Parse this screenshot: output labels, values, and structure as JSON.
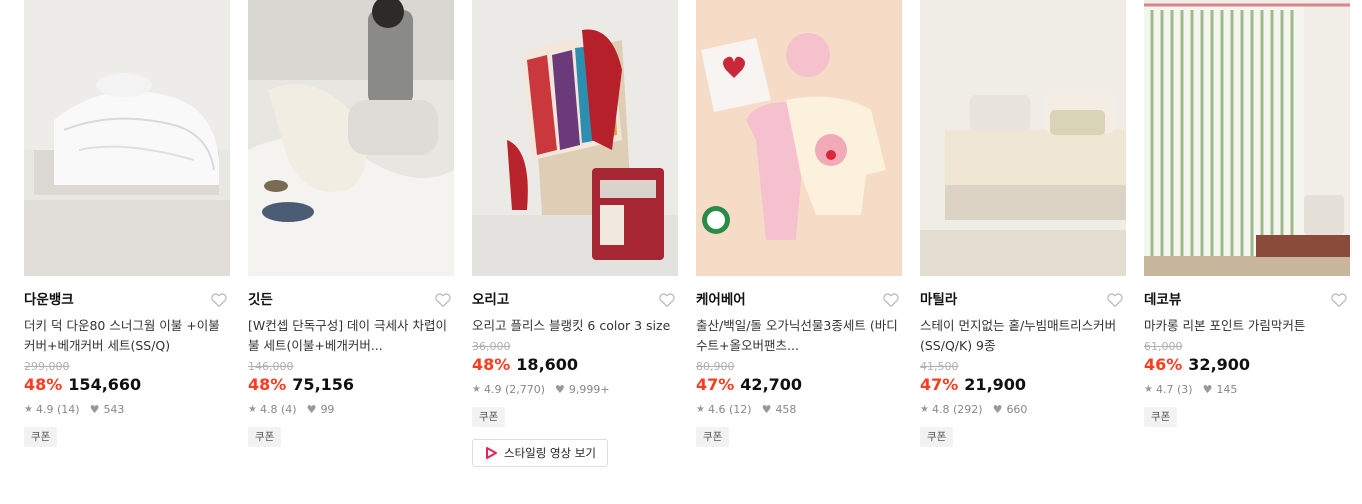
{
  "products": [
    {
      "brand": "다운뱅크",
      "title": "더키 덕 다운80 스너그웜 이불 +이불커버+베개커버 세트(SS/Q)",
      "original_price": "299,000",
      "discount": "48%",
      "price": "154,660",
      "rating": "4.9",
      "reviews": "(14)",
      "likes": "543",
      "coupon": "쿠폰"
    },
    {
      "brand": "깃든",
      "title": "[W컨셉 단독구성] 데이 극세사 차렵이불 세트(이불+베개커버...",
      "original_price": "146,000",
      "discount": "48%",
      "price": "75,156",
      "rating": "4.8",
      "reviews": "(4)",
      "likes": "99",
      "coupon": "쿠폰"
    },
    {
      "brand": "오리고",
      "title": "오리고 플리스 블랭킷 6 color 3 size",
      "original_price": "36,000",
      "discount": "48%",
      "price": "18,600",
      "rating": "4.9",
      "reviews": "(2,770)",
      "likes": "9,999+",
      "coupon": "쿠폰",
      "video_label": "스타일링 영상 보기"
    },
    {
      "brand": "케어베어",
      "title": "출산/백일/돌 오가닉선물3종세트 (바디수트+올오버팬츠...",
      "original_price": "80,900",
      "discount": "47%",
      "price": "42,700",
      "rating": "4.6",
      "reviews": "(12)",
      "likes": "458",
      "coupon": "쿠폰"
    },
    {
      "brand": "마틸라",
      "title": "스테이 먼지없는 홑/누빔매트리스커버 (SS/Q/K) 9종",
      "original_price": "41,500",
      "discount": "47%",
      "price": "21,900",
      "rating": "4.8",
      "reviews": "(292)",
      "likes": "660",
      "coupon": "쿠폰"
    },
    {
      "brand": "데코뷰",
      "title": "마카롱 리본 포인트 가림막커튼",
      "original_price": "61,000",
      "discount": "46%",
      "price": "32,900",
      "rating": "4.7",
      "reviews": "(3)",
      "likes": "145",
      "coupon": "쿠폰"
    }
  ],
  "colors": {
    "discount": "#ff3b1f",
    "video_icon": "#e8225a"
  },
  "icons": {
    "wish": "heart-outline-icon",
    "rating": "star-icon",
    "likes": "heart-filled-icon",
    "video": "play-icon"
  }
}
